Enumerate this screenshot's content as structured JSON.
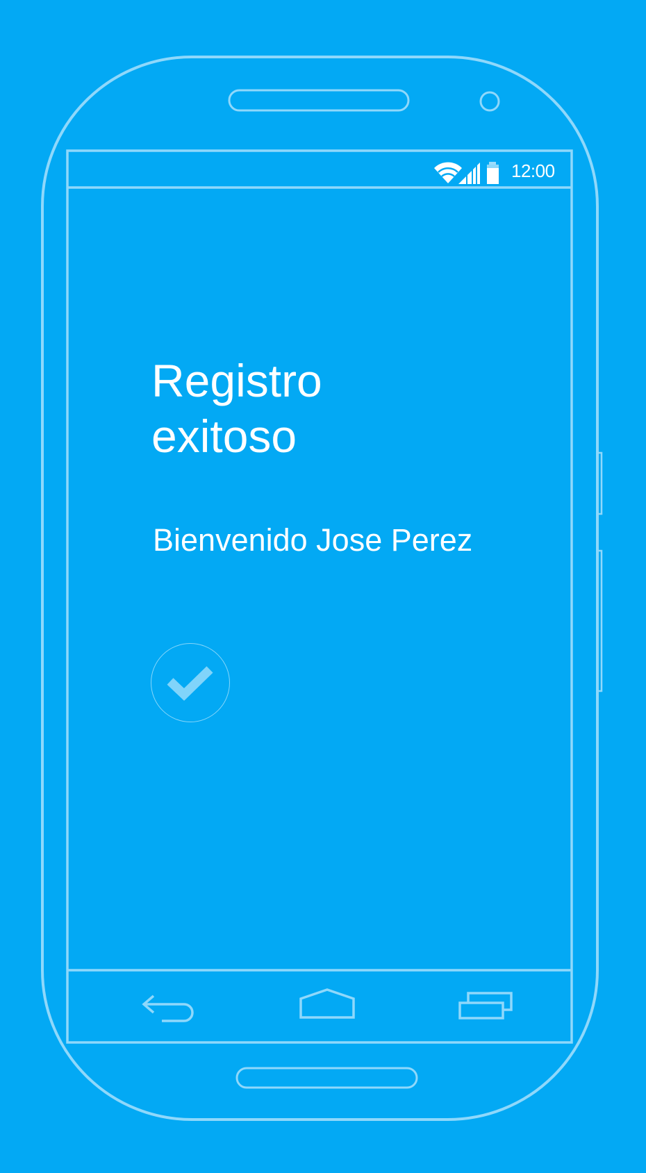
{
  "status_bar": {
    "time": "12:00",
    "icons": [
      "wifi-icon",
      "signal-icon",
      "battery-icon"
    ]
  },
  "content": {
    "title": "Registro\nexitoso",
    "welcome": "Bienvenido Jose Perez",
    "confirm_icon": "check-circle-icon"
  },
  "nav_bar": {
    "buttons": [
      "back-icon",
      "home-icon",
      "recent-apps-icon"
    ]
  },
  "colors": {
    "background": "#03a9f4",
    "outline": "#81d4fa",
    "text": "#ffffff",
    "check": "#81d4fa"
  }
}
